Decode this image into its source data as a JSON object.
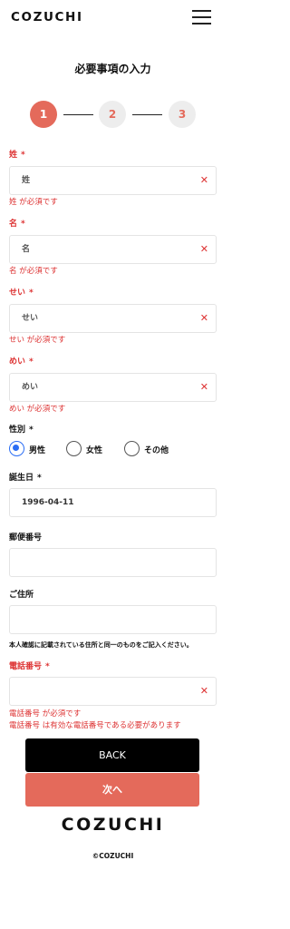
{
  "header": {
    "logo": "COZUCHI"
  },
  "page_title": "必要事項の入力",
  "steps": [
    {
      "number": "1",
      "active": true
    },
    {
      "number": "2",
      "active": false
    },
    {
      "number": "3",
      "active": false
    }
  ],
  "fields": {
    "last_name": {
      "label": "姓",
      "required_mark": "*",
      "placeholder": "姓",
      "value": "",
      "error": "姓 が必須です"
    },
    "first_name": {
      "label": "名",
      "required_mark": "*",
      "placeholder": "名",
      "value": "",
      "error": "名 が必須です"
    },
    "last_name_kana": {
      "label": "せい",
      "required_mark": "*",
      "placeholder": "せい",
      "value": "",
      "error": "せい が必須です"
    },
    "first_name_kana": {
      "label": "めい",
      "required_mark": "*",
      "placeholder": "めい",
      "value": "",
      "error": "めい が必須です"
    },
    "gender": {
      "label": "性別",
      "required_mark": "*",
      "options": [
        "男性",
        "女性",
        "その他"
      ],
      "selected": "男性"
    },
    "birthday": {
      "label": "誕生日",
      "required_mark": "*",
      "value": "1996-04-11"
    },
    "postal_code": {
      "label": "郵便番号",
      "value": ""
    },
    "address": {
      "label": "ご住所",
      "value": ""
    },
    "address_note": "本人確認に記載されている住所と同一のものをご記入ください。",
    "phone": {
      "label": "電話番号",
      "required_mark": "*",
      "value": "",
      "error_required": "電話番号 が必須です",
      "error_invalid": "電話番号 は有効な電話番号である必要があります"
    }
  },
  "buttons": {
    "back": "BACK",
    "next": "次へ"
  },
  "footer": {
    "logo": "COZUCHI",
    "copyright": "©COZUCHI"
  },
  "colors": {
    "accent": "#e46a5b",
    "error": "#dd3333",
    "radio": "#2a6df4"
  }
}
